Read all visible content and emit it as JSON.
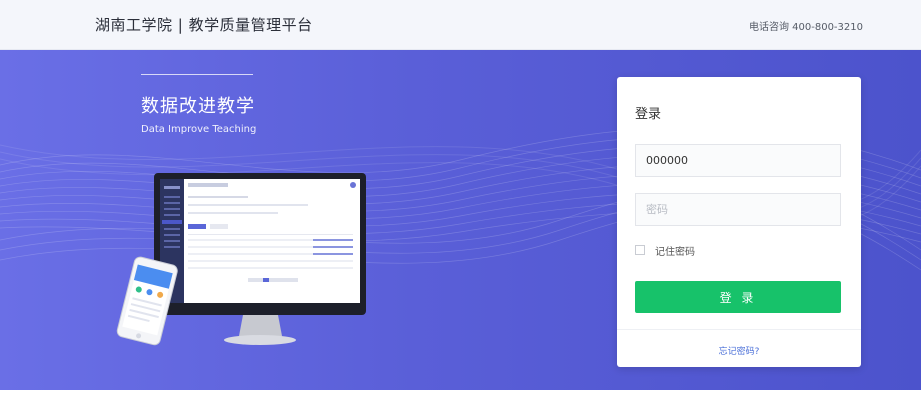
{
  "header": {
    "brand_title": "湖南工学院 | 教学质量管理平台",
    "phone_text": "电话咨询 400-800-3210"
  },
  "hero": {
    "slogan_cn": "数据改进教学",
    "slogan_en": "Data Improve Teaching"
  },
  "login": {
    "title": "登录",
    "username_value": "000000",
    "password_placeholder": "密码",
    "remember_label": "记住密码",
    "remember_checked": false,
    "submit_label": "登 录",
    "forgot_label": "忘记密码?"
  },
  "colors": {
    "hero_start": "#6a6fe6",
    "hero_end": "#4c53cc",
    "button": "#17c26a",
    "link": "#4a6fd8"
  }
}
